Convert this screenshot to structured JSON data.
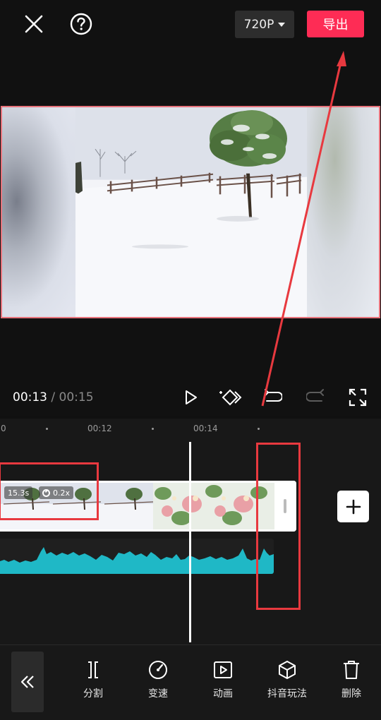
{
  "header": {
    "resolution_label": "720P",
    "export_label": "导出"
  },
  "player": {
    "current_time": "00:13",
    "separator": " / ",
    "total_time": "00:15"
  },
  "timeline": {
    "ruler_labels": [
      "0",
      "00:12",
      "00:14"
    ],
    "clip_duration": "15.3s",
    "clip_speed": "0.2x"
  },
  "toolbar": {
    "items": [
      {
        "label": "分割",
        "icon": "split-icon"
      },
      {
        "label": "变速",
        "icon": "speed-icon"
      },
      {
        "label": "动画",
        "icon": "animation-icon"
      },
      {
        "label": "抖音玩法",
        "icon": "cube-icon"
      },
      {
        "label": "删除",
        "icon": "trash-icon"
      }
    ]
  },
  "colors": {
    "export_accent": "#fe2c55",
    "annotation_red": "#e8393f",
    "audio_wave": "#1fb8c6"
  }
}
